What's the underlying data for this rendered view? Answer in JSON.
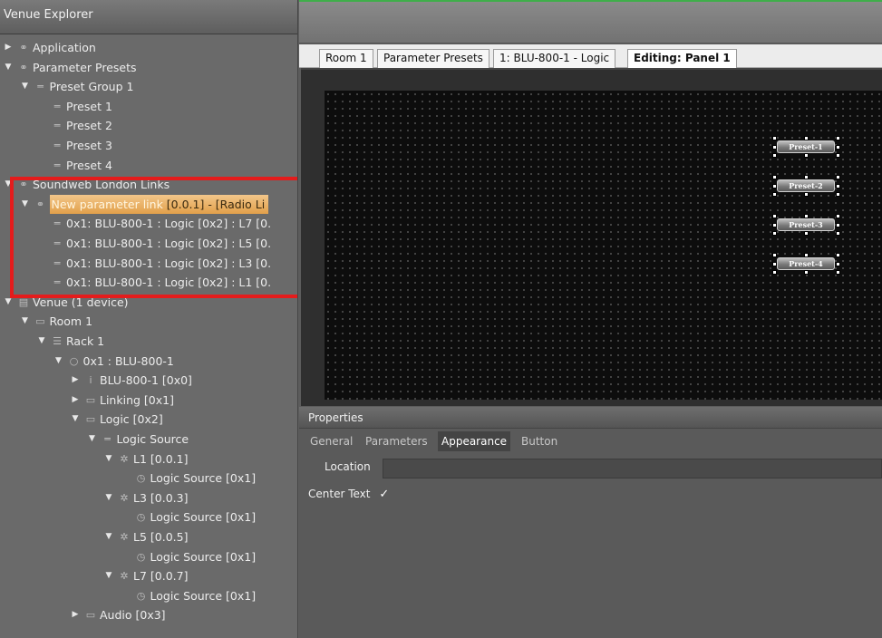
{
  "explorer": {
    "title": "Venue Explorer",
    "tree": [
      {
        "label": "Application",
        "level": 0,
        "arrow": "collapsed",
        "icon": "link-icon"
      },
      {
        "label": "Parameter Presets",
        "level": 0,
        "arrow": "expanded",
        "icon": "link-icon"
      },
      {
        "label": "Preset Group 1",
        "level": 1,
        "arrow": "expanded",
        "icon": "preset-icon"
      },
      {
        "label": "Preset 1",
        "level": 2,
        "arrow": "none",
        "icon": "preset-icon"
      },
      {
        "label": "Preset 2",
        "level": 2,
        "arrow": "none",
        "icon": "preset-icon"
      },
      {
        "label": "Preset 3",
        "level": 2,
        "arrow": "none",
        "icon": "preset-icon"
      },
      {
        "label": "Preset 4",
        "level": 2,
        "arrow": "none",
        "icon": "preset-icon"
      },
      {
        "label": "Soundweb London Links",
        "level": 0,
        "arrow": "expanded",
        "icon": "link-icon"
      },
      {
        "label": "New parameter link",
        "extra": " [0.0.1]  -  [Radio Li",
        "level": 1,
        "arrow": "expanded",
        "icon": "link-icon",
        "selected": true
      },
      {
        "label": "0x1: BLU-800-1 : Logic [0x2] : L7 [0.",
        "level": 2,
        "arrow": "none",
        "icon": "preset-icon"
      },
      {
        "label": "0x1: BLU-800-1 : Logic [0x2] : L5 [0.",
        "level": 2,
        "arrow": "none",
        "icon": "preset-icon"
      },
      {
        "label": "0x1: BLU-800-1 : Logic [0x2] : L3 [0.",
        "level": 2,
        "arrow": "none",
        "icon": "preset-icon"
      },
      {
        "label": "0x1: BLU-800-1 : Logic [0x2] : L1 [0.",
        "level": 2,
        "arrow": "none",
        "icon": "preset-icon"
      },
      {
        "label": "Venue (1 device)",
        "level": 0,
        "arrow": "expanded",
        "icon": "venue-icon"
      },
      {
        "label": "Room 1",
        "level": 1,
        "arrow": "expanded",
        "icon": "room-icon"
      },
      {
        "label": "Rack 1",
        "level": 2,
        "arrow": "expanded",
        "icon": "rack-icon"
      },
      {
        "label": "0x1 : BLU-800-1",
        "level": 3,
        "arrow": "expanded",
        "icon": "device-icon"
      },
      {
        "label": "BLU-800-1 [0x0]",
        "level": 4,
        "arrow": "collapsed",
        "icon": "info-icon"
      },
      {
        "label": "Linking [0x1]",
        "level": 4,
        "arrow": "collapsed",
        "icon": "folder-icon"
      },
      {
        "label": "Logic [0x2]",
        "level": 4,
        "arrow": "expanded",
        "icon": "folder-icon"
      },
      {
        "label": "Logic Source",
        "level": 5,
        "arrow": "expanded",
        "icon": "preset-icon"
      },
      {
        "label": "L1 [0.0.1]",
        "level": 6,
        "arrow": "expanded",
        "icon": "gear-icon"
      },
      {
        "label": "Logic Source [0x1]",
        "level": 7,
        "arrow": "none",
        "icon": "clock-icon"
      },
      {
        "label": "L3 [0.0.3]",
        "level": 6,
        "arrow": "expanded",
        "icon": "gear-icon"
      },
      {
        "label": "Logic Source [0x1]",
        "level": 7,
        "arrow": "none",
        "icon": "clock-icon"
      },
      {
        "label": "L5 [0.0.5]",
        "level": 6,
        "arrow": "expanded",
        "icon": "gear-icon"
      },
      {
        "label": "Logic Source [0x1]",
        "level": 7,
        "arrow": "none",
        "icon": "clock-icon"
      },
      {
        "label": "L7 [0.0.7]",
        "level": 6,
        "arrow": "expanded",
        "icon": "gear-icon"
      },
      {
        "label": "Logic Source [0x1]",
        "level": 7,
        "arrow": "none",
        "icon": "clock-icon"
      },
      {
        "label": "Audio [0x3]",
        "level": 4,
        "arrow": "collapsed",
        "icon": "folder-icon"
      }
    ]
  },
  "tabs": [
    {
      "label": "Room 1",
      "active": false
    },
    {
      "label": "Parameter Presets",
      "active": false
    },
    {
      "label": "1: BLU-800-1 - Logic",
      "active": false
    },
    {
      "label": "Editing: Panel 1",
      "active": true
    }
  ],
  "canvas": {
    "presets": [
      "Preset-1",
      "Preset-2",
      "Preset-3",
      "Preset-4"
    ]
  },
  "properties": {
    "title": "Properties",
    "tabs": [
      {
        "label": "General",
        "active": false
      },
      {
        "label": "Parameters",
        "active": false
      },
      {
        "label": "Appearance",
        "active": true
      },
      {
        "label": "Button",
        "active": false
      }
    ],
    "location_label": "Location",
    "location_value": "",
    "center_text_label": "Center Text",
    "center_text_checked": "✓"
  },
  "colors": {
    "highlight": "#e41c1c",
    "selection": "#e2a04a",
    "accent": "#3fae4a"
  }
}
